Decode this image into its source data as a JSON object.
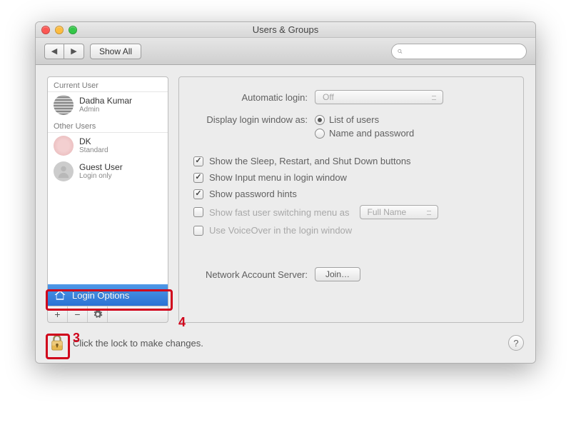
{
  "window": {
    "title": "Users & Groups"
  },
  "toolbar": {
    "show_all": "Show All",
    "search_placeholder": ""
  },
  "sidebar": {
    "current_user_hdr": "Current User",
    "other_users_hdr": "Other Users",
    "current_user": {
      "name": "Dadha Kumar",
      "role": "Admin"
    },
    "others": [
      {
        "name": "DK",
        "role": "Standard"
      },
      {
        "name": "Guest User",
        "role": "Login only"
      }
    ],
    "login_options": "Login Options",
    "buttons": {
      "add": "+",
      "remove": "−",
      "gear": "✽"
    }
  },
  "panel": {
    "auto_login_label": "Automatic login:",
    "auto_login_value": "Off",
    "display_login_label": "Display login window as:",
    "display_login_opts": [
      "List of users",
      "Name and password"
    ],
    "checks": {
      "sleep": "Show the Sleep, Restart, and Shut Down buttons",
      "input_menu": "Show Input menu in login window",
      "hints": "Show password hints",
      "fast_switch": "Show fast user switching menu as",
      "voiceover": "Use VoiceOver in the login window"
    },
    "fast_switch_value": "Full Name",
    "net_server_label": "Network Account Server:",
    "join_btn": "Join…"
  },
  "footer": {
    "lock_text": "Click the lock to make changes.",
    "help": "?"
  },
  "annotations": {
    "a3": "3",
    "a4": "4"
  }
}
